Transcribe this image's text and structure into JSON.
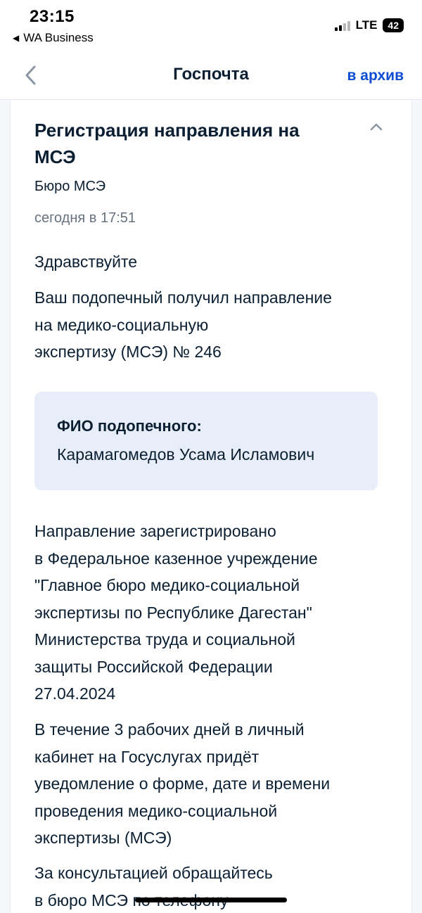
{
  "status_bar": {
    "time": "23:15",
    "back_app": "WA Business",
    "network": "LTE",
    "battery": "42"
  },
  "nav": {
    "title": "Госпочта",
    "action": "в архив"
  },
  "message": {
    "title": "Регистрация направления на МСЭ",
    "sender": "Бюро МСЭ",
    "date": "сегодня в 17:51",
    "greeting": "Здравствуйте",
    "paragraph1": "Ваш подопечный получил направление\nна медико-социальную\nэкспертизу (МСЭ) № 246",
    "fio_label": "ФИО подопечного:",
    "fio_name": "Карамагомедов Усама Исламович",
    "paragraph2": "Направление зарегистрировано\nв Федеральное казенное учреждение\n\"Главное бюро медико-социальной\nэкспертизы по Республике Дагестан\"\nМинистерства труда и социальной\nзащиты Российской Федерации\n27.04.2024",
    "paragraph3": "В течение 3 рабочих дней в личный\nкабинет на Госуслугах придёт\nуведомление о форме, дате и времени\nпроведения медико-социальной\nэкспертизы (МСЭ)",
    "paragraph4": "За консультацией обращайтесь\nв бюро МСЭ по телефону"
  },
  "colors": {
    "accent": "#0d4cd3",
    "text": "#0b1f33",
    "muted": "#66727f",
    "info_box": "#e8eef9"
  },
  "icons": {
    "nav_back": "chevron-left-icon",
    "collapse": "chevron-up-icon"
  }
}
